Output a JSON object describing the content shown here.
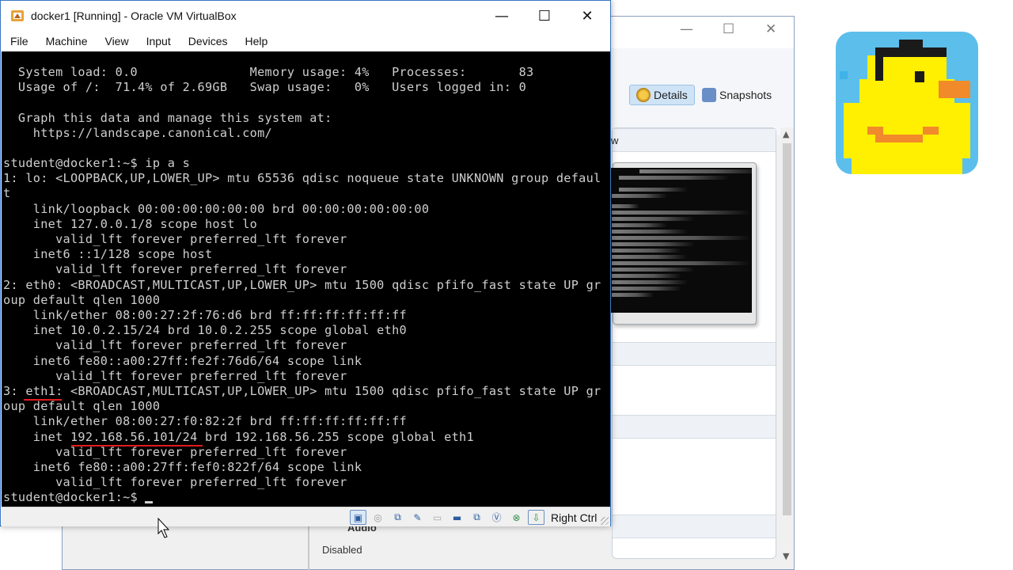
{
  "vm_window": {
    "title": "docker1 [Running] - Oracle VM VirtualBox",
    "controls": {
      "minimize": "—",
      "maximize": "☐",
      "close": "✕"
    },
    "menu": [
      "File",
      "Machine",
      "View",
      "Input",
      "Devices",
      "Help"
    ]
  },
  "terminal": {
    "lines": [
      "  System load: 0.0               Memory usage: 4%   Processes:       83",
      "  Usage of /:  71.4% of 2.69GB   Swap usage:   0%   Users logged in: 0",
      "",
      "  Graph this data and manage this system at:",
      "    https://landscape.canonical.com/",
      "",
      "student@docker1:~$ ip a s",
      "1: lo: <LOOPBACK,UP,LOWER_UP> mtu 65536 qdisc noqueue state UNKNOWN group defaul",
      "t",
      "    link/loopback 00:00:00:00:00:00 brd 00:00:00:00:00:00",
      "    inet 127.0.0.1/8 scope host lo",
      "       valid_lft forever preferred_lft forever",
      "    inet6 ::1/128 scope host",
      "       valid_lft forever preferred_lft forever",
      "2: eth0: <BROADCAST,MULTICAST,UP,LOWER_UP> mtu 1500 qdisc pfifo_fast state UP gr",
      "oup default qlen 1000",
      "    link/ether 08:00:27:2f:76:d6 brd ff:ff:ff:ff:ff:ff",
      "    inet 10.0.2.15/24 brd 10.0.2.255 scope global eth0",
      "       valid_lft forever preferred_lft forever",
      "    inet6 fe80::a00:27ff:fe2f:76d6/64 scope link",
      "       valid_lft forever preferred_lft forever",
      "3: eth1: <BROADCAST,MULTICAST,UP,LOWER_UP> mtu 1500 qdisc pfifo_fast state UP gr",
      "oup default qlen 1000",
      "    link/ether 08:00:27:f0:82:2f brd ff:ff:ff:ff:ff:ff",
      "    inet 192.168.56.101/24 brd 192.168.56.255 scope global eth1",
      "       valid_lft forever preferred_lft forever",
      "    inet6 fe80::a00:27ff:fef0:822f/64 scope link",
      "       valid_lft forever preferred_lft forever",
      "student@docker1:~$ "
    ]
  },
  "statusbar": {
    "icons": [
      "hard-disk-icon",
      "optical-drive-icon",
      "network-icon",
      "usb-icon",
      "shared-folders-icon",
      "display-icon",
      "video-capture-icon",
      "recording-icon",
      "virtualization-icon",
      "mouse-integration-icon"
    ],
    "host_key": "Right Ctrl"
  },
  "manager_window": {
    "controls": {
      "minimize": "—",
      "maximize": "☐",
      "close": "✕"
    },
    "details_button": "Details",
    "snapshots_button": "Snapshots",
    "audio_section_partial": "Audio",
    "audio_value_partial": "Disabled",
    "preview_section_partial": "w"
  },
  "colors": {
    "terminal_bg": "#000000",
    "terminal_fg": "#cfcfcf",
    "annotation_red": "#e21b1b",
    "window_border": "#3b77c2"
  }
}
